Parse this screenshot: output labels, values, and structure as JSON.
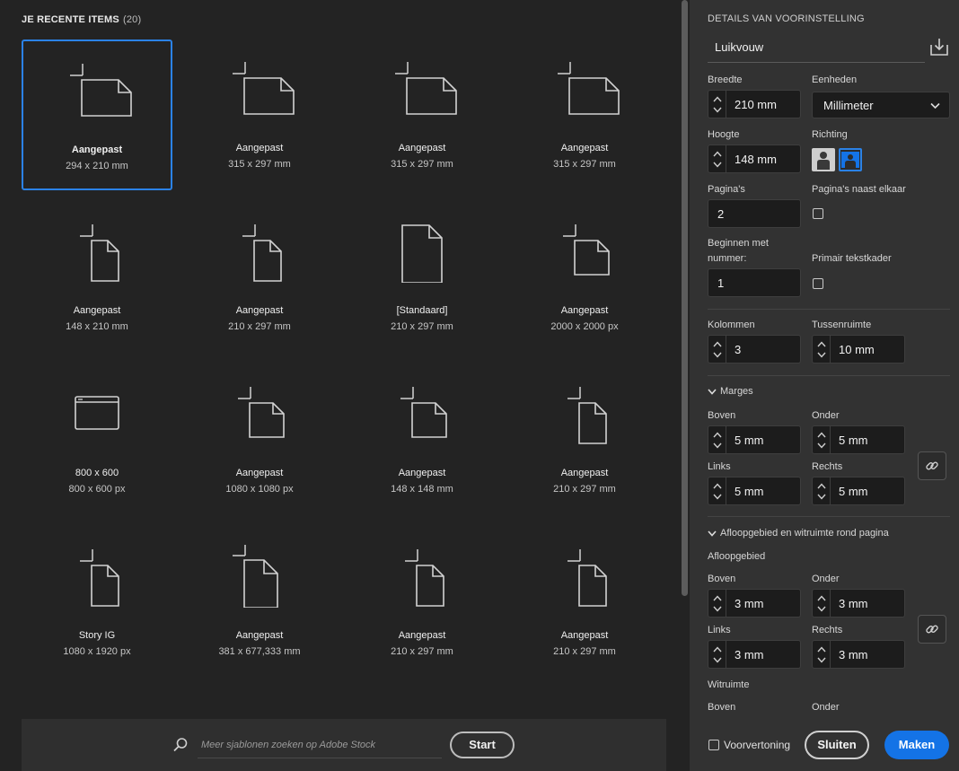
{
  "recent": {
    "title": "JE RECENTE ITEMS",
    "count": "(20)",
    "items": [
      {
        "name": "Aangepast",
        "dims": "294 x 210 mm",
        "icon": "custom-landscape-icon",
        "selected": true
      },
      {
        "name": "Aangepast",
        "dims": "315 x 297 mm",
        "icon": "custom-landscape-icon"
      },
      {
        "name": "Aangepast",
        "dims": "315 x 297 mm",
        "icon": "custom-landscape-icon"
      },
      {
        "name": "Aangepast",
        "dims": "315 x 297 mm",
        "icon": "custom-landscape-icon"
      },
      {
        "name": "Aangepast",
        "dims": "148 x 210 mm",
        "icon": "custom-portrait-icon"
      },
      {
        "name": "Aangepast",
        "dims": "210 x 297 mm",
        "icon": "custom-portrait-icon"
      },
      {
        "name": "[Standaard]",
        "dims": "210 x 297 mm",
        "icon": "document-icon"
      },
      {
        "name": "Aangepast",
        "dims": "2000 x 2000 px",
        "icon": "custom-square-icon"
      },
      {
        "name": "800 x 600",
        "dims": "800 x 600 px",
        "icon": "browser-window-icon"
      },
      {
        "name": "Aangepast",
        "dims": "1080 x 1080 px",
        "icon": "custom-square-icon"
      },
      {
        "name": "Aangepast",
        "dims": "148 x 148 mm",
        "icon": "custom-square-icon"
      },
      {
        "name": "Aangepast",
        "dims": "210 x 297 mm",
        "icon": "custom-portrait-icon"
      },
      {
        "name": "Story IG",
        "dims": "1080 x 1920 px",
        "icon": "custom-portrait-icon"
      },
      {
        "name": "Aangepast",
        "dims": "381 x 677,333 mm",
        "icon": "custom-tall-icon"
      },
      {
        "name": "Aangepast",
        "dims": "210 x 297 mm",
        "icon": "custom-portrait-icon"
      },
      {
        "name": "Aangepast",
        "dims": "210 x 297 mm",
        "icon": "custom-portrait-icon"
      }
    ]
  },
  "search": {
    "placeholder": "Meer sjablonen zoeken op Adobe Stock",
    "button": "Start"
  },
  "details": {
    "title": "DETAILS VAN VOORINSTELLING",
    "preset_name": "Luikvouw",
    "width_label": "Breedte",
    "width": "210 mm",
    "units_label": "Eenheden",
    "units": "Millimeter",
    "height_label": "Hoogte",
    "height": "148 mm",
    "orientation_label": "Richting",
    "pages_label": "Pagina's",
    "pages": "2",
    "facing_label": "Pagina's naast elkaar",
    "start_label_1": "Beginnen met",
    "start_label_2": "nummer:",
    "start": "1",
    "primary_frame_label": "Primair tekstkader",
    "columns_label": "Kolommen",
    "columns": "3",
    "gutter_label": "Tussenruimte",
    "gutter": "10 mm",
    "margins_head": "Marges",
    "top_label": "Boven",
    "bottom_label": "Onder",
    "left_label": "Links",
    "right_label": "Rechts",
    "margin_top": "5 mm",
    "margin_bottom": "5 mm",
    "margin_left": "5 mm",
    "margin_right": "5 mm",
    "bleed_head": "Afloopgebied en witruimte rond pagina",
    "bleed_label": "Afloopgebied",
    "bleed_top": "3 mm",
    "bleed_bottom": "3 mm",
    "bleed_left": "3 mm",
    "bleed_right": "3 mm",
    "slug_label": "Witruimte"
  },
  "footer": {
    "preview": "Voorvertoning",
    "close": "Sluiten",
    "make": "Maken"
  },
  "colors": {
    "accent": "#1473e6",
    "selection": "#2b82e6"
  }
}
